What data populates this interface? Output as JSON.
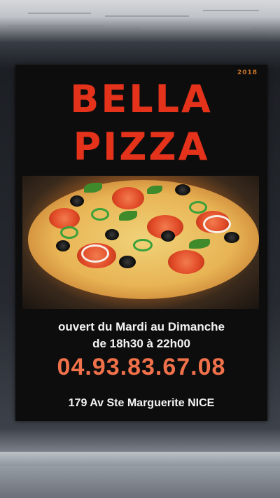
{
  "poster": {
    "year": "2018",
    "title_line1": "BELLA",
    "title_line2": "PIZZA",
    "hours_line1": "ouvert du Mardi au Dimanche",
    "hours_line2": "de 18h30 à 22h00",
    "phone": "04.93.83.67.08",
    "address": "179 Av Ste Marguerite NICE"
  },
  "colors": {
    "title": "#e4321b",
    "phone": "#f0714a",
    "background": "#0e0d0d"
  }
}
